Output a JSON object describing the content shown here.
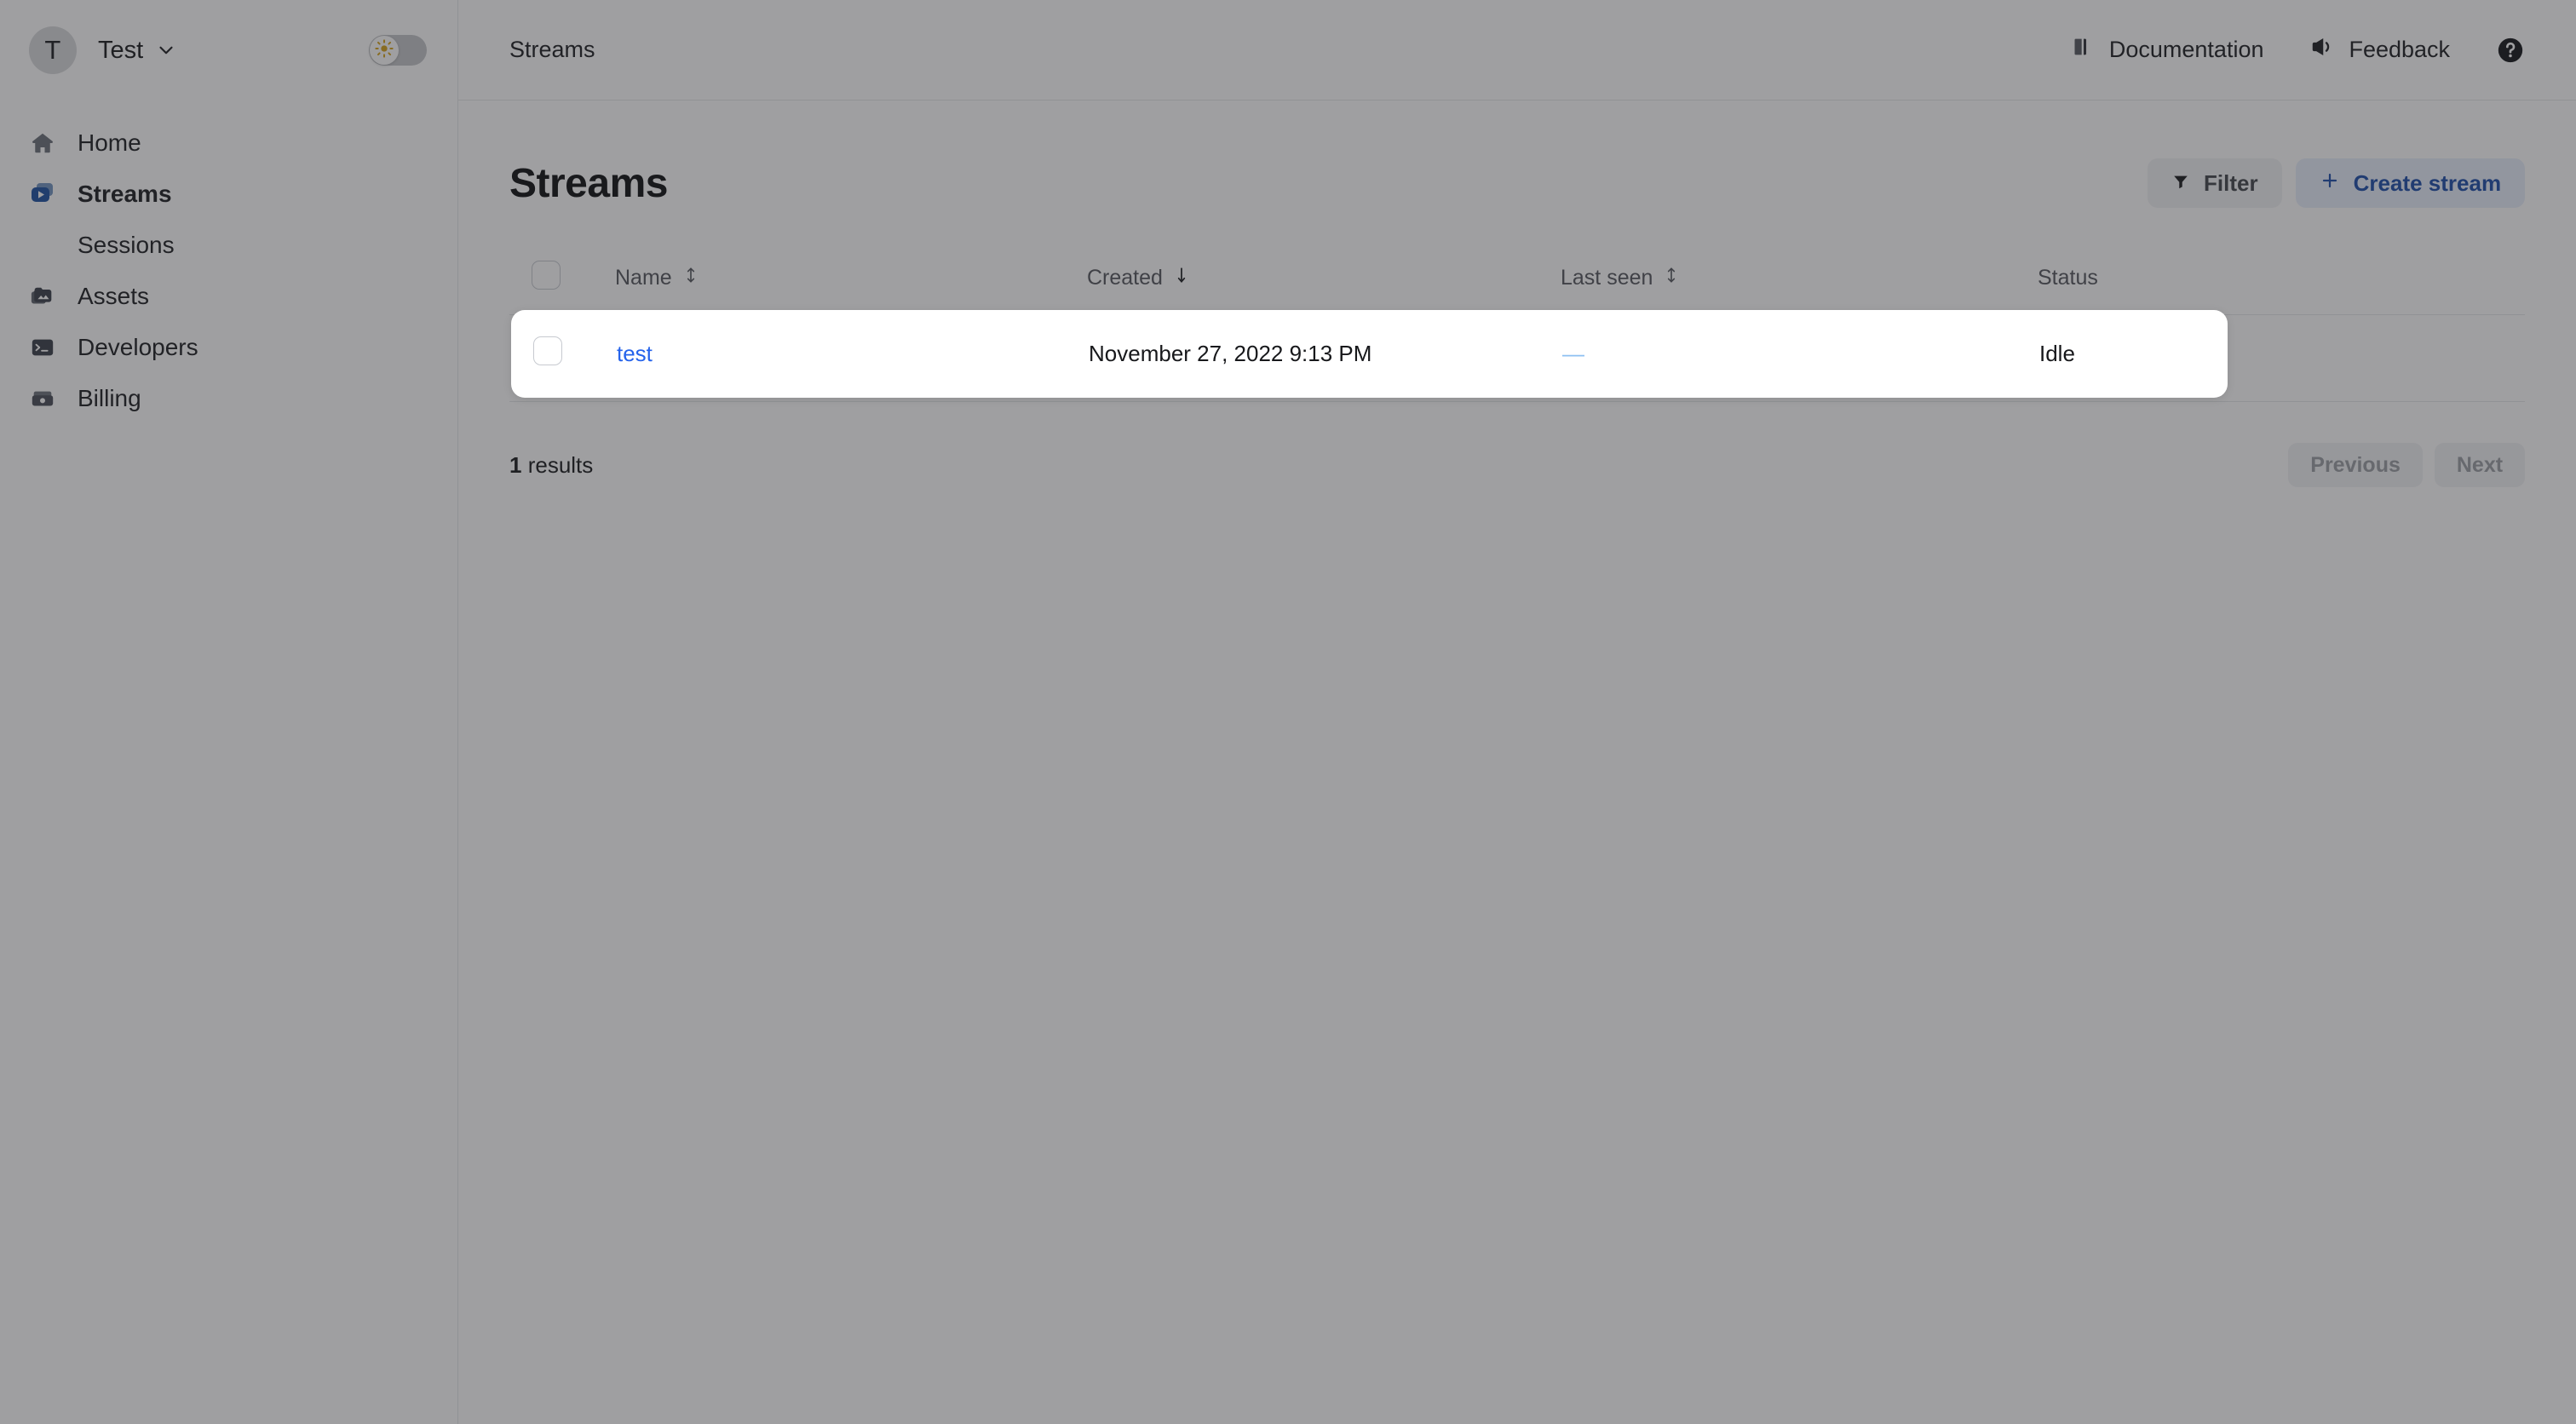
{
  "sidebar": {
    "org": {
      "avatar_initial": "T",
      "name": "Test",
      "chevron_icon": "chevron-down-icon"
    },
    "theme_toggle": {
      "icon": "sun-icon",
      "state": "light"
    },
    "items": [
      {
        "label": "Home",
        "icon": "home-icon",
        "active": false,
        "sub": false
      },
      {
        "label": "Streams",
        "icon": "stream-play-icon",
        "active": true,
        "sub": false
      },
      {
        "label": "Sessions",
        "icon": "",
        "active": false,
        "sub": true
      },
      {
        "label": "Assets",
        "icon": "assets-icon",
        "active": false,
        "sub": false
      },
      {
        "label": "Developers",
        "icon": "terminal-icon",
        "active": false,
        "sub": false
      },
      {
        "label": "Billing",
        "icon": "billing-icon",
        "active": false,
        "sub": false
      }
    ]
  },
  "topbar": {
    "breadcrumb": "Streams",
    "documentation_label": "Documentation",
    "documentation_icon": "book-icon",
    "feedback_label": "Feedback",
    "feedback_icon": "megaphone-icon",
    "help_icon": "help-circle-icon"
  },
  "page": {
    "title": "Streams",
    "filter_label": "Filter",
    "filter_icon": "funnel-icon",
    "create_label": "Create stream",
    "create_icon": "plus-icon"
  },
  "table": {
    "select_all_checkbox": "unchecked",
    "columns": [
      {
        "label": "Name",
        "sort_icon": "sort-both-icon"
      },
      {
        "label": "Created",
        "sort_icon": "sort-desc-icon"
      },
      {
        "label": "Last seen",
        "sort_icon": "sort-both-icon"
      },
      {
        "label": "Status",
        "sort_icon": ""
      }
    ],
    "rows": [
      {
        "checkbox": "unchecked",
        "name": "test",
        "created": "November 27, 2022 9:13 PM",
        "last_seen": "—",
        "status": "Idle"
      }
    ]
  },
  "footer": {
    "results_count": "1",
    "results_label": "results",
    "previous_label": "Previous",
    "next_label": "Next"
  },
  "colors": {
    "link": "#2563eb",
    "primary_button_bg": "#e8eefc",
    "primary_button_text": "#1b4ca8",
    "overlay": "rgba(42,43,46,0.45)",
    "accent_stream_icon": "#1a4fa0",
    "sun_icon": "#d6a319"
  }
}
